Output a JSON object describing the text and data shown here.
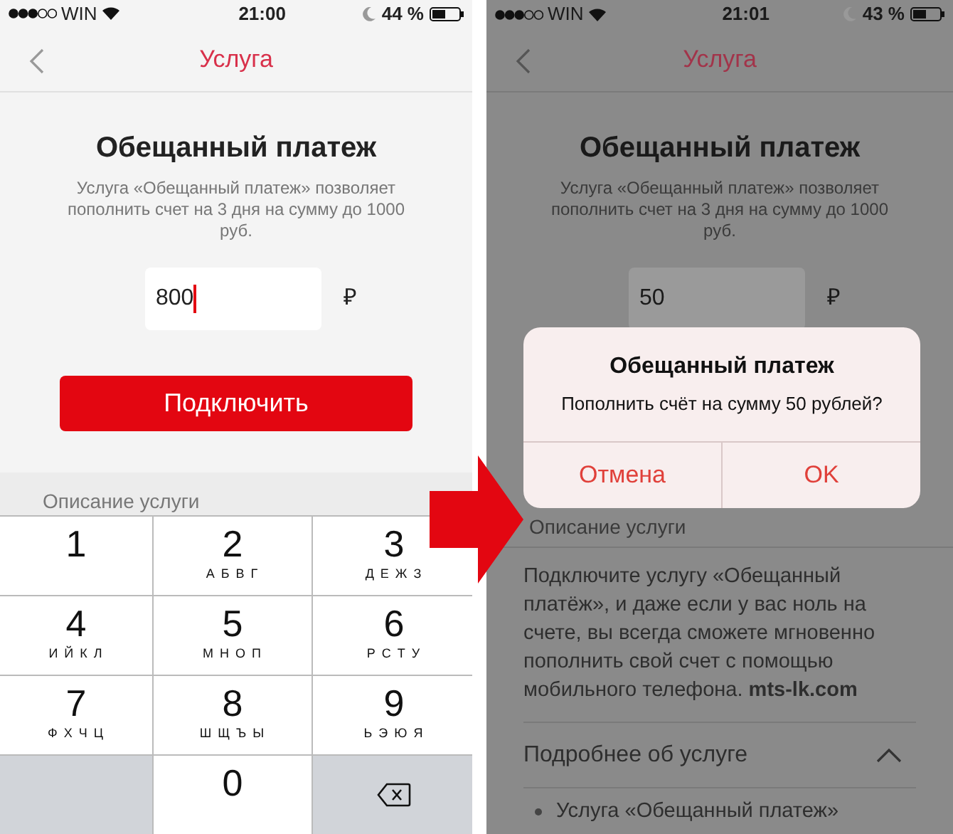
{
  "screens": [
    {
      "dimmed": false,
      "status_bar": {
        "carrier": "WIN",
        "time": "21:00",
        "battery": "44 %"
      },
      "nav": {
        "title": "Услуга"
      },
      "heading": "Обещанный платеж",
      "description": "Услуга «Обещанный платеж» позволяет пополнить счет на 3 дня на сумму до 1000 руб.",
      "amount_field": {
        "value": "800",
        "focused": true
      },
      "currency": "₽",
      "connect_button": "Подключить",
      "section_title": "Описание услуги",
      "keypad": [
        {
          "kind": "digit",
          "digit": "1"
        },
        {
          "kind": "digit",
          "digit": "2",
          "letters": "А Б В Г"
        },
        {
          "kind": "digit",
          "digit": "3",
          "letters": "Д Е Ж З"
        },
        {
          "kind": "digit",
          "digit": "4",
          "letters": "И Й К Л"
        },
        {
          "kind": "digit",
          "digit": "5",
          "letters": "М Н О П"
        },
        {
          "kind": "digit",
          "digit": "6",
          "letters": "Р С Т У"
        },
        {
          "kind": "digit",
          "digit": "7",
          "letters": "Ф Х Ч Ц"
        },
        {
          "kind": "digit",
          "digit": "8",
          "letters": "Ш Щ Ъ Ы"
        },
        {
          "kind": "digit",
          "digit": "9",
          "letters": "Ь Э Ю Я"
        },
        {
          "kind": "blank"
        },
        {
          "kind": "digit",
          "digit": "0"
        },
        {
          "kind": "delete"
        }
      ]
    },
    {
      "dimmed": true,
      "status_bar": {
        "carrier": "WIN",
        "time": "21:01",
        "battery": "43 %"
      },
      "nav": {
        "title": "Услуга"
      },
      "heading": "Обещанный платеж",
      "description": "Услуга «Обещанный платеж» позволяет пополнить счет на 3 дня на сумму до 1000 руб.",
      "amount_field": {
        "value": "50",
        "focused": false
      },
      "currency": "₽",
      "section_title": "Описание услуги",
      "paragraph": "Подключите услугу «Обещанный платёж», и даже если у вас ноль на счете, вы всегда сможете мгновенно пополнить свой счет с помощью мобильного телефона. **mts-lk.com**",
      "details": {
        "title": "Подробнее об услуге",
        "expanded": true,
        "items": [
          "Услуга «Обещанный платеж»"
        ]
      },
      "dialog": {
        "title": "Обещанный платеж",
        "message": "Пополнить счёт на сумму 50 рублей?",
        "buttons": [
          "Отмена",
          "OK"
        ]
      }
    }
  ]
}
